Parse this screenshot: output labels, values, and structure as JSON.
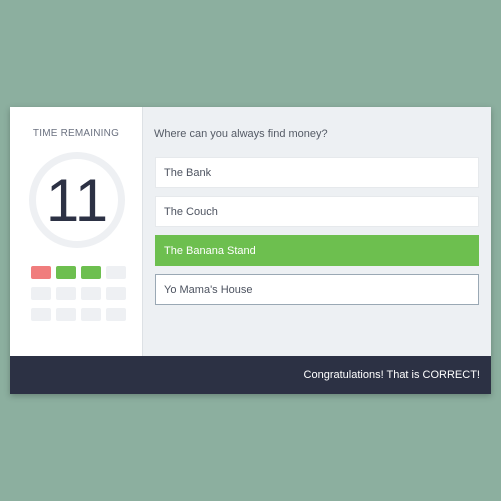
{
  "timer": {
    "label": "TIME REMAINING",
    "value": "11"
  },
  "progress": [
    "wrong",
    "right",
    "right",
    "empty",
    "empty",
    "empty",
    "empty",
    "empty",
    "empty",
    "empty",
    "empty",
    "empty"
  ],
  "question": "Where can you always find money?",
  "answers": [
    {
      "label": "The Bank",
      "state": "default"
    },
    {
      "label": "The Couch",
      "state": "default"
    },
    {
      "label": "The Banana Stand",
      "state": "correct"
    },
    {
      "label": "Yo Mama's House",
      "state": "outlined"
    }
  ],
  "footer": {
    "message": "Congratulations! That is CORRECT!"
  },
  "colors": {
    "background": "#8caf9f",
    "correct": "#6dbf4f",
    "wrong": "#f07d7d",
    "footer": "#2c3144"
  }
}
